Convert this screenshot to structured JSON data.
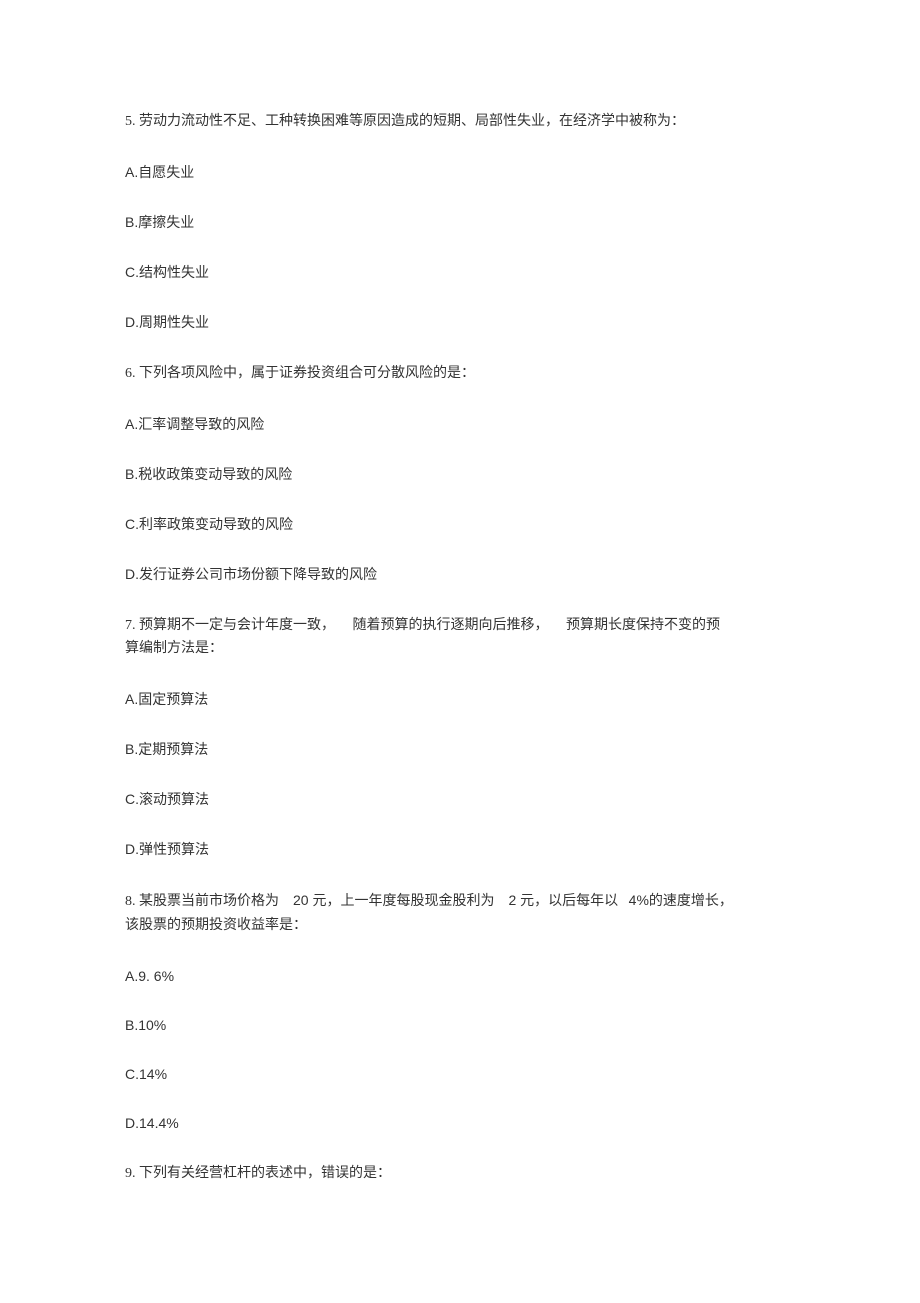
{
  "q5": {
    "text": "5. 劳动力流动性不足、工种转换困难等原因造成的短期、局部性失业，在经济学中被称为：",
    "options": {
      "A": "A.自愿失业",
      "B": "B.摩擦失业",
      "C": "C.结构性失业",
      "D": "D.周期性失业"
    }
  },
  "q6": {
    "text": "6. 下列各项风险中，属于证券投资组合可分散风险的是：",
    "options": {
      "A": "A.汇率调整导致的风险",
      "B": "B.税收政策变动导致的风险",
      "C": "C.利率政策变动导致的风险",
      "D": "D.发行证券公司市场份额下降导致的风险"
    }
  },
  "q7": {
    "part1": "7. 预算期不一定与会计年度一致，",
    "part2": "随着预算的执行逐期向后推移，",
    "part3": "预算期长度保持不变的预",
    "part4": "算编制方法是：",
    "options": {
      "A": "A.固定预算法",
      "B": "B.定期预算法",
      "C": "C.滚动预算法",
      "D": "D.弹性预算法"
    }
  },
  "q8": {
    "part1": "8. 某股票当前市场价格为",
    "part2": "20 元，上一年度每股现金股利为",
    "part3": "2 元，以后每年以",
    "part4": "4%的速度增长，",
    "part5": "该股票的预期投资收益率是：",
    "options": {
      "A": "A.9. 6%",
      "B": "B.10%",
      "C": "C.14%",
      "D": "D.14.4%"
    }
  },
  "q9": {
    "text": "9. 下列有关经营杠杆的表述中，错误的是："
  }
}
